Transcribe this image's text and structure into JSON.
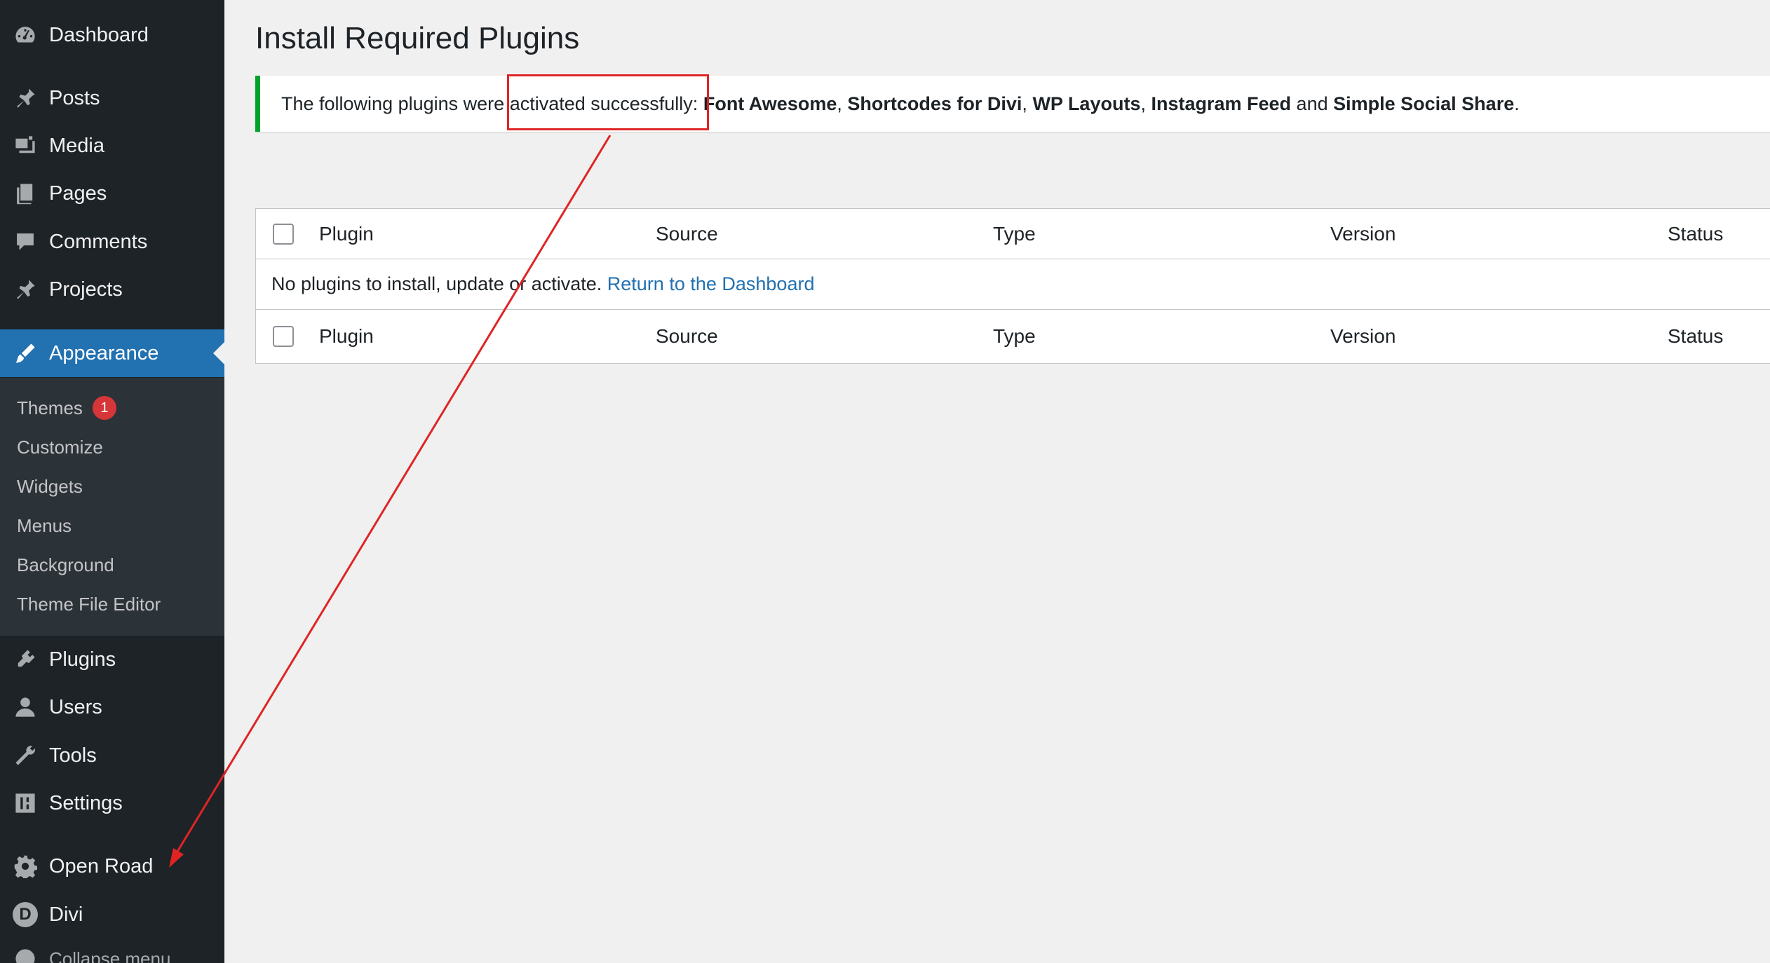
{
  "sidebar": {
    "items": [
      {
        "label": "Dashboard",
        "icon": "dashboard-icon"
      },
      {
        "label": "Posts",
        "icon": "pin-icon"
      },
      {
        "label": "Media",
        "icon": "media-icon"
      },
      {
        "label": "Pages",
        "icon": "pages-icon"
      },
      {
        "label": "Comments",
        "icon": "comment-icon"
      },
      {
        "label": "Projects",
        "icon": "pin-icon"
      },
      {
        "label": "Appearance",
        "icon": "brush-icon"
      },
      {
        "label": "Plugins",
        "icon": "plugin-icon"
      },
      {
        "label": "Users",
        "icon": "user-icon"
      },
      {
        "label": "Tools",
        "icon": "wrench-icon"
      },
      {
        "label": "Settings",
        "icon": "sliders-icon"
      },
      {
        "label": "Open Road",
        "icon": "gear-icon"
      },
      {
        "label": "Divi",
        "icon": "divi-icon",
        "letter": "D"
      },
      {
        "label": "Collapse menu",
        "icon": "collapse-icon"
      }
    ],
    "submenu": [
      {
        "label": "Themes",
        "badge": "1"
      },
      {
        "label": "Customize"
      },
      {
        "label": "Widgets"
      },
      {
        "label": "Menus"
      },
      {
        "label": "Background"
      },
      {
        "label": "Theme File Editor"
      }
    ]
  },
  "main": {
    "title": "Install Required Plugins",
    "notice": {
      "prefix": "The following plugins were ",
      "highlighted": "activated successfully:",
      "plugins": [
        "Font Awesome",
        "Shortcodes for Divi",
        "WP Layouts",
        "Instagram Feed",
        "Simple Social Share"
      ],
      "sep": ", ",
      "conjunction": " and ",
      "end": "."
    },
    "table": {
      "columns": [
        "Plugin",
        "Source",
        "Type",
        "Version",
        "Status"
      ],
      "empty_text": "No plugins to install, update or activate. ",
      "empty_link": "Return to the Dashboard"
    }
  },
  "colors": {
    "sidebar_bg": "#1d2327",
    "accent": "#2271b1",
    "success": "#00a32a",
    "annotation": "#e02424"
  }
}
